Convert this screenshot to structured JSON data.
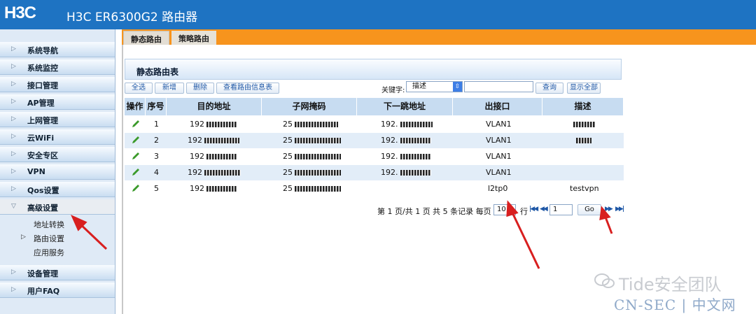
{
  "header": {
    "logo": "H3C",
    "title": "H3C ER6300G2 路由器"
  },
  "sidebar": {
    "items": [
      {
        "label": "系统导航"
      },
      {
        "label": "系统监控"
      },
      {
        "label": "接口管理"
      },
      {
        "label": "AP管理"
      },
      {
        "label": "上网管理"
      },
      {
        "label": "云WiFi"
      },
      {
        "label": "安全专区"
      },
      {
        "label": "VPN"
      },
      {
        "label": "Qos设置"
      },
      {
        "label": "高级设置"
      }
    ],
    "subitems": [
      {
        "label": "地址转换"
      },
      {
        "label": "路由设置"
      },
      {
        "label": "应用服务"
      }
    ],
    "bottom_items": [
      {
        "label": "设备管理"
      },
      {
        "label": "用户FAQ"
      }
    ]
  },
  "tabs": [
    {
      "label": "静态路由"
    },
    {
      "label": "策略路由"
    }
  ],
  "panel": {
    "title": "静态路由表"
  },
  "toolbar": {
    "select_all": "全选",
    "add": "新增",
    "delete": "删除",
    "view_route_info": "查看路由信息表",
    "keyword_label": "关键字:",
    "keyword_select": "描述",
    "keyword_value": "",
    "query": "查询",
    "show_all": "显示全部"
  },
  "table": {
    "headers": [
      "操作",
      "序号",
      "目的地址",
      "子网掩码",
      "下一跳地址",
      "出接口",
      "描述"
    ],
    "rows": [
      {
        "no": "1",
        "dest": "192",
        "mask": "25",
        "next_hop": "192.",
        "iface": "VLAN1",
        "desc": ""
      },
      {
        "no": "2",
        "dest": "192",
        "mask": "25",
        "next_hop": "192.",
        "iface": "VLAN1",
        "desc": ""
      },
      {
        "no": "3",
        "dest": "192",
        "mask": "25",
        "next_hop": "192.",
        "iface": "VLAN1",
        "desc": ""
      },
      {
        "no": "4",
        "dest": "192",
        "mask": "25",
        "next_hop": "192.",
        "iface": "VLAN1",
        "desc": ""
      },
      {
        "no": "5",
        "dest": "192",
        "mask": "25",
        "next_hop": "",
        "iface": "l2tp0",
        "desc": "testvpn"
      }
    ]
  },
  "pager": {
    "summary": "第 1 页/共 1 页 共 5 条记录 每页",
    "per_page": "10",
    "row_label": "行",
    "page_input": "1",
    "go": "Go"
  },
  "watermark": {
    "text": "Tide安全团队",
    "footer": "CN-SEC | 中文网"
  },
  "colors": {
    "header": "#1e73c2",
    "tabbar": "#f7941d",
    "arrow": "#d81f1f"
  }
}
